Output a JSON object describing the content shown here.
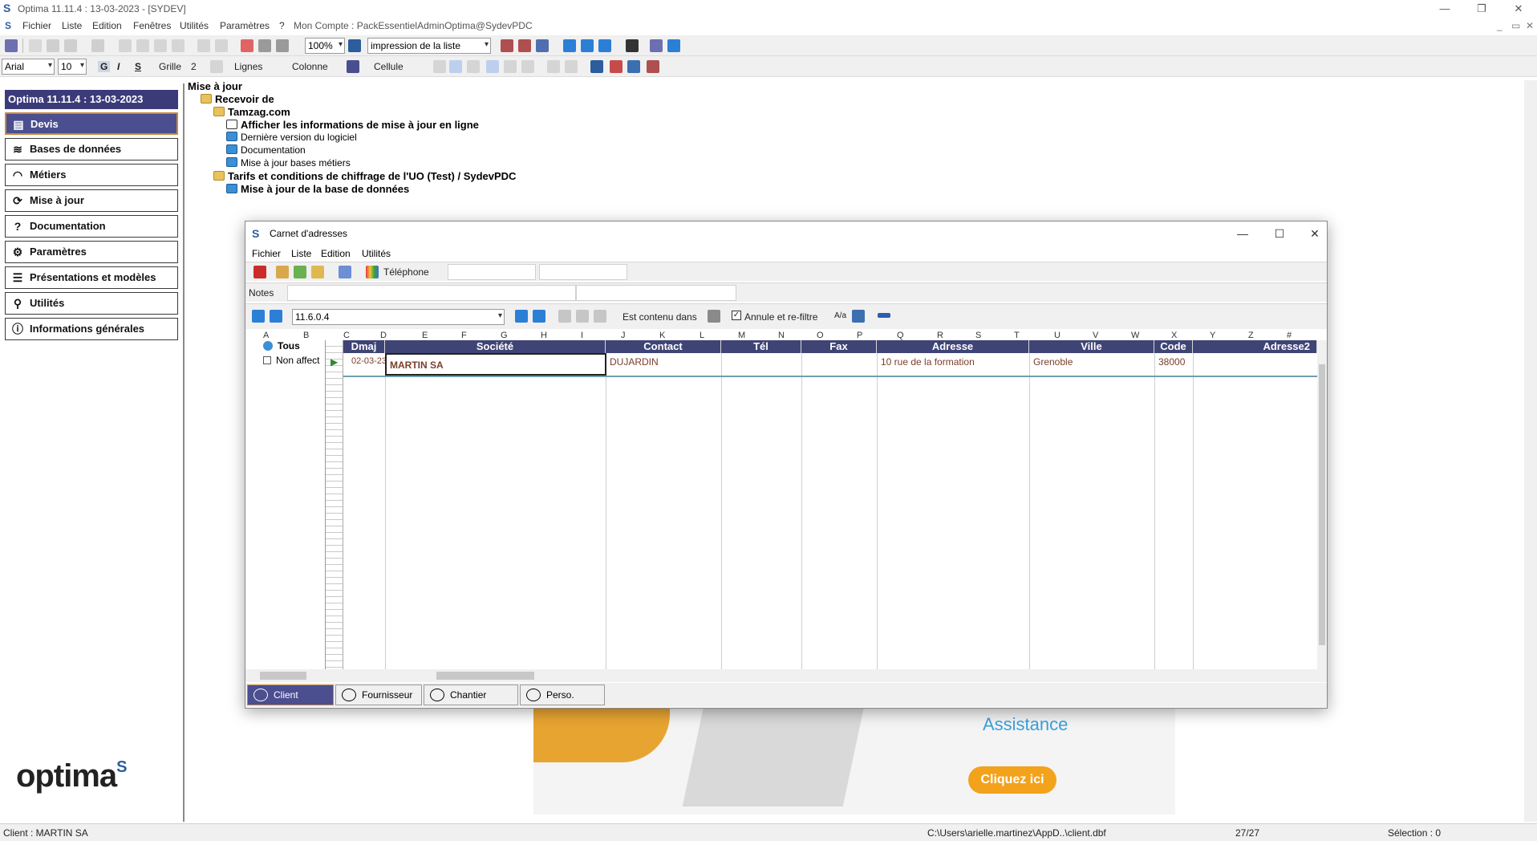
{
  "window": {
    "title": "Optima 11.11.4 : 13-03-2023 - [SYDEV]",
    "controls": [
      "—",
      "❐",
      "✕"
    ]
  },
  "menubar": {
    "items": [
      "Fichier",
      "Liste",
      "Edition",
      "Fenêtres",
      "Utilités",
      "Paramètres",
      "?"
    ],
    "account": "Mon Compte : PackEssentielAdminOptima@SydevPDC"
  },
  "toolbar1": {
    "zoom": "100%",
    "print_mode": "impression de la liste"
  },
  "toolbar2": {
    "font": "Arial",
    "font_size": "10",
    "bold": "G",
    "italic": "I",
    "strike": "S",
    "grille_label": "Grille",
    "grille_value": "2",
    "lignes_label": "Lignes",
    "colonne_label": "Colonne",
    "cellule_label": "Cellule"
  },
  "sidebar": {
    "header": "Optima 11.11.4 : 13-03-2023",
    "items": [
      {
        "label": "Devis",
        "icon": "document-icon"
      },
      {
        "label": "Bases de données",
        "icon": "layers-icon"
      },
      {
        "label": "Métiers",
        "icon": "helmet-icon"
      },
      {
        "label": "Mise à jour",
        "icon": "refresh-icon"
      },
      {
        "label": "Documentation",
        "icon": "help-icon"
      },
      {
        "label": "Paramètres",
        "icon": "gear-icon"
      },
      {
        "label": "Présentations et modèles",
        "icon": "template-icon"
      },
      {
        "label": "Utilités",
        "icon": "tool-icon"
      },
      {
        "label": "Informations générales",
        "icon": "info-icon"
      }
    ],
    "logo_text": "optima"
  },
  "tree": {
    "root": "Mise à jour",
    "recevoir": "Recevoir de",
    "tamzag": "Tamzag.com",
    "afficher": "Afficher les informations de mise à jour en ligne",
    "derniere": "Dernière version du logiciel",
    "documentation": "Documentation",
    "bases_metiers": "Mise à jour bases métiers",
    "tarifs": "Tarifs et conditions de chiffrage de l'UO (Test) / SydevPDC",
    "maj_base": "Mise à jour de la base de données"
  },
  "banner": {
    "assistance": "Assistance",
    "cta": "Cliquez ici"
  },
  "dialog": {
    "title": "Carnet d'adresses",
    "menu": [
      "Fichier",
      "Liste",
      "Edition",
      "Utilités"
    ],
    "telephone_label": "Téléphone",
    "notes_label": "Notes",
    "version_combo": "11.6.0.4",
    "est_contenu": "Est contenu dans",
    "annule_refiltre": "Annule et re-filtre",
    "annule_checked": true,
    "col_letters": [
      "A",
      "B",
      "C",
      "D",
      "E",
      "F",
      "G",
      "H",
      "I",
      "J",
      "K",
      "L",
      "M",
      "N",
      "O",
      "P",
      "Q",
      "R",
      "S",
      "T",
      "U",
      "V",
      "W",
      "X",
      "Y",
      "Z",
      "#"
    ],
    "tree_items": [
      "Tous",
      "Non affect"
    ],
    "columns": [
      "Dmaj",
      "Société",
      "Contact",
      "Tél",
      "Fax",
      "Adresse",
      "Ville",
      "Code",
      "Adresse2"
    ],
    "rows": [
      {
        "dmaj": "02-03-23",
        "societe": "MARTIN SA",
        "contact": "DUJARDIN",
        "tel": "",
        "fax": "",
        "adresse": "10 rue de la formation",
        "ville": "Grenoble",
        "code": "38000",
        "adresse2": ""
      }
    ],
    "tabs": [
      "Client",
      "Fournisseur",
      "Chantier",
      "Perso."
    ]
  },
  "statusbar": {
    "client": "Client : MARTIN SA",
    "path": "C:\\Users\\arielle.martinez\\AppD..\\client.dbf",
    "count": "27/27",
    "selection": "Sélection : 0"
  }
}
